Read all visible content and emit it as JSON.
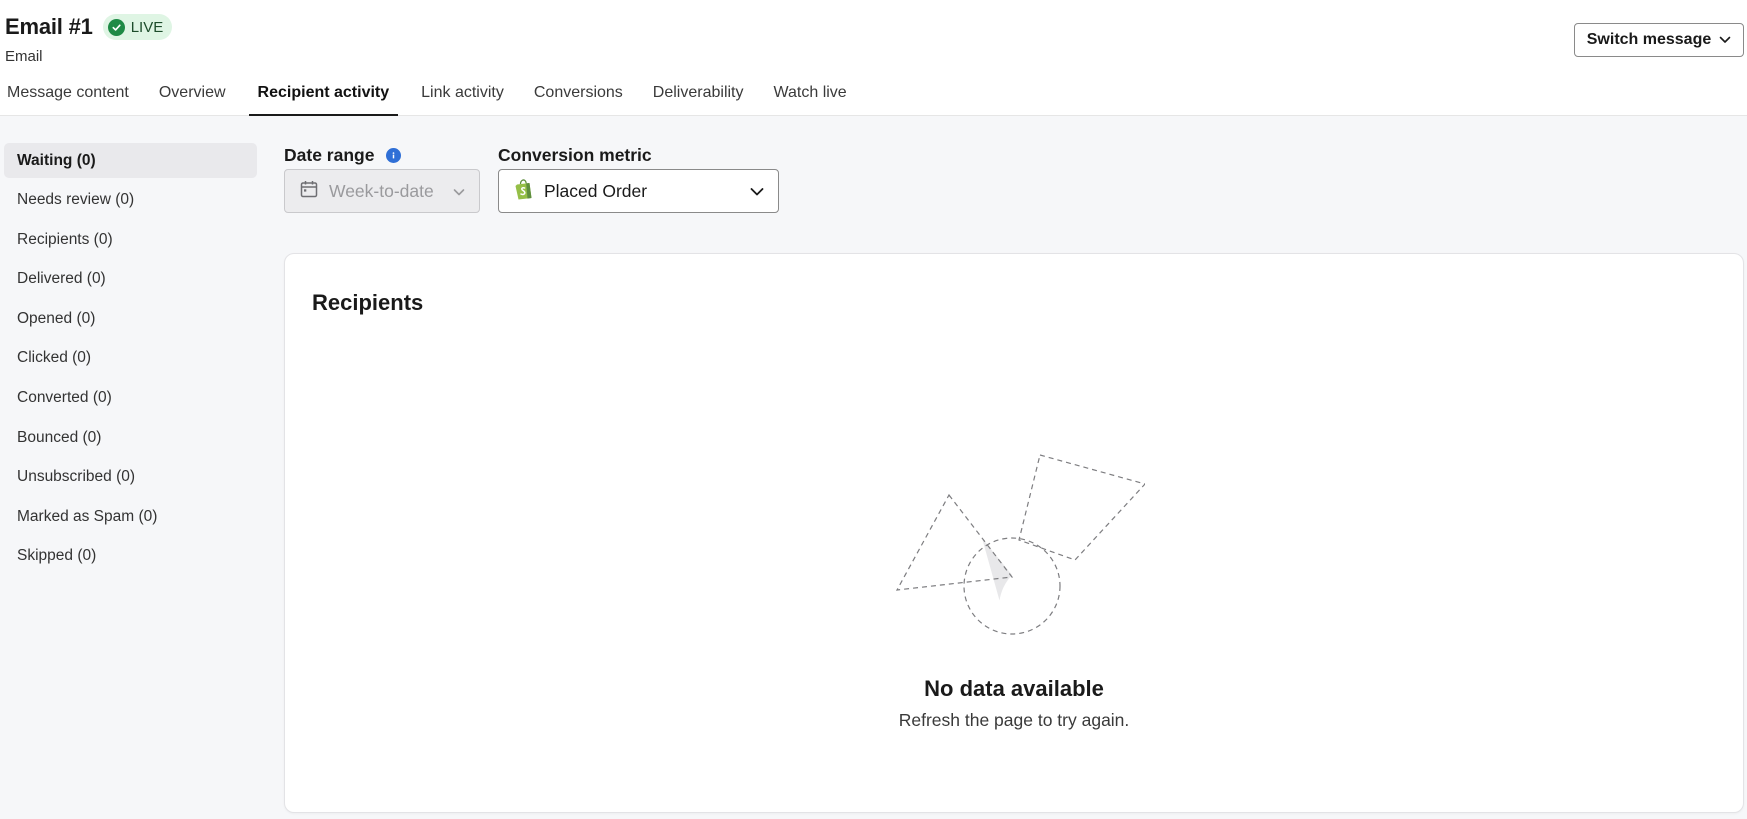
{
  "header": {
    "title": "Email #1",
    "status_badge": "LIVE",
    "subtitle": "Email",
    "switch_label": "Switch message"
  },
  "tabs": [
    {
      "label": "Message content",
      "active": false
    },
    {
      "label": "Overview",
      "active": false
    },
    {
      "label": "Recipient activity",
      "active": true
    },
    {
      "label": "Link activity",
      "active": false
    },
    {
      "label": "Conversions",
      "active": false
    },
    {
      "label": "Deliverability",
      "active": false
    },
    {
      "label": "Watch live",
      "active": false
    }
  ],
  "sidebar": {
    "items": [
      {
        "label": "Waiting (0)",
        "active": true
      },
      {
        "label": "Needs review (0)",
        "active": false
      },
      {
        "label": "Recipients (0)",
        "active": false
      },
      {
        "label": "Delivered (0)",
        "active": false
      },
      {
        "label": "Opened (0)",
        "active": false
      },
      {
        "label": "Clicked (0)",
        "active": false
      },
      {
        "label": "Converted (0)",
        "active": false
      },
      {
        "label": "Bounced (0)",
        "active": false
      },
      {
        "label": "Unsubscribed (0)",
        "active": false
      },
      {
        "label": "Marked as Spam (0)",
        "active": false
      },
      {
        "label": "Skipped (0)",
        "active": false
      }
    ]
  },
  "filters": {
    "date_range_label": "Date range",
    "date_range_value": "Week-to-date",
    "conversion_metric_label": "Conversion metric",
    "conversion_metric_value": "Placed Order"
  },
  "card": {
    "title": "Recipients",
    "empty_title": "No data available",
    "empty_subtitle": "Refresh the page to try again."
  },
  "icons": {
    "badge_check": "check-circle-icon",
    "switch_caret": "chevron-down-icon",
    "info": "info-icon",
    "calendar": "calendar-icon",
    "metric_source": "shopify-bag-icon",
    "empty_state": "shapes-illustration"
  },
  "colors": {
    "live_badge_bg": "#dff5e4",
    "live_check": "#1e8a45",
    "info_blue": "#2f6fd6",
    "shopify_green": "#95bf47"
  }
}
